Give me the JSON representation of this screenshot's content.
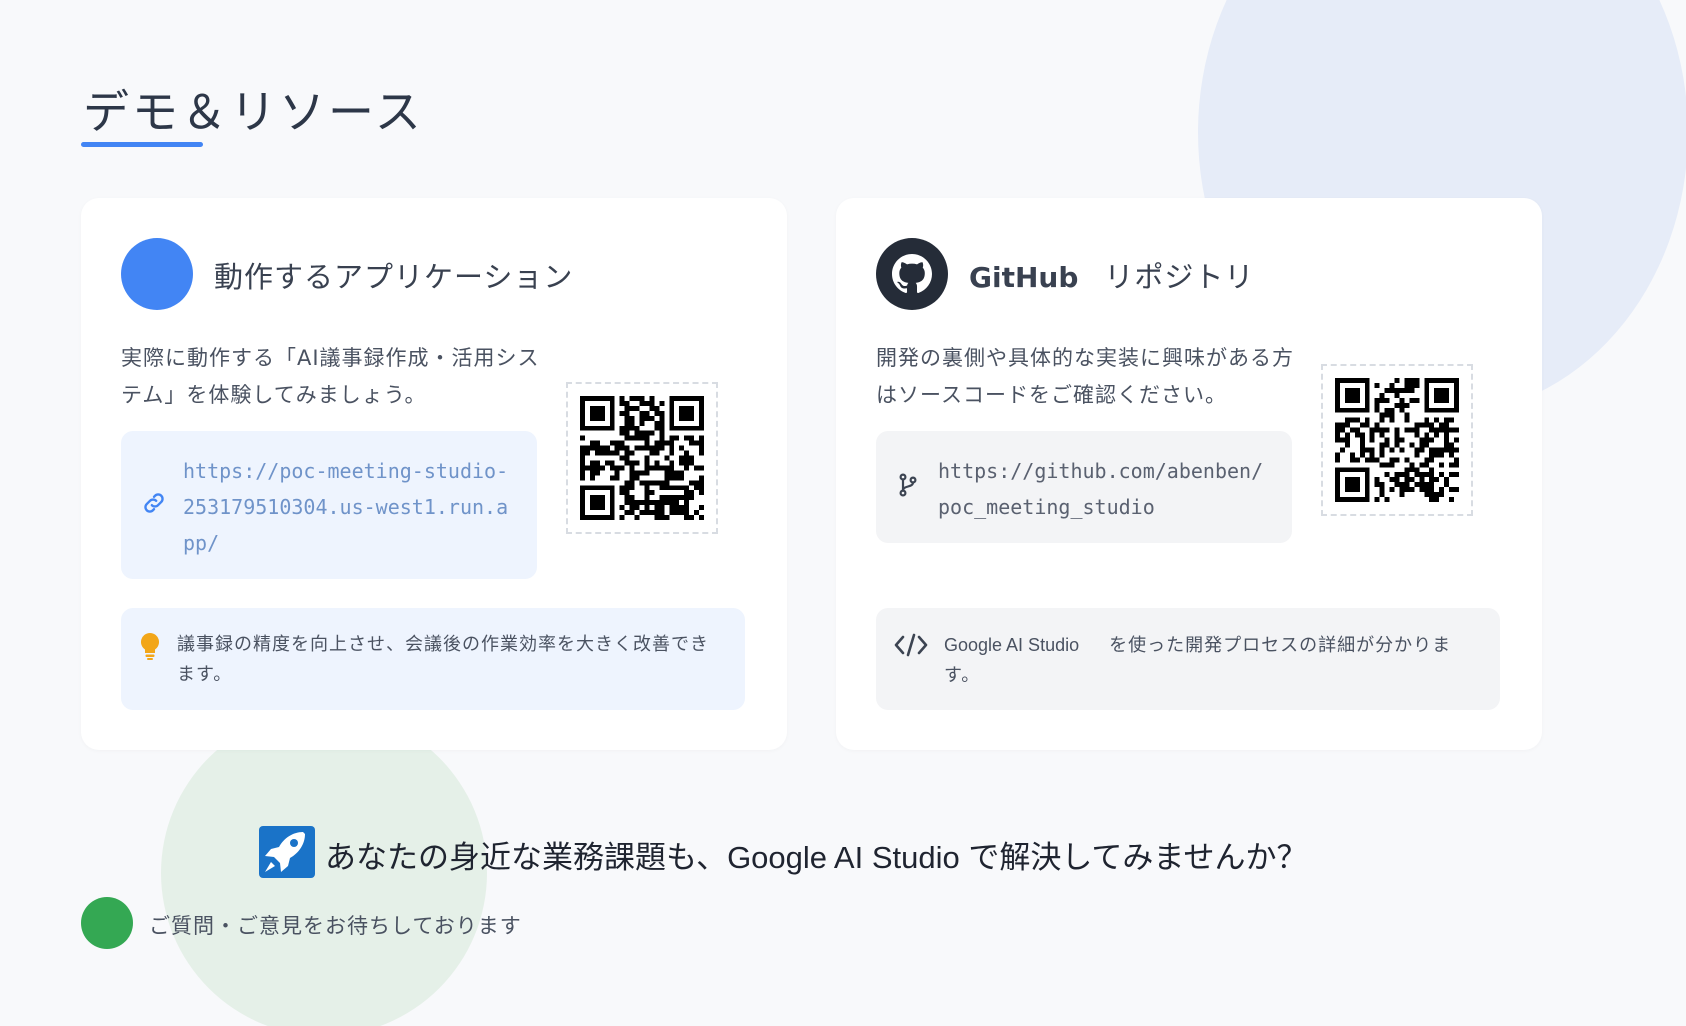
{
  "page": {
    "title": "デモ＆リソース"
  },
  "colors": {
    "accent_blue": "#4285f4",
    "dark": "#252c38",
    "green": "#34a853",
    "amber": "#f2a619"
  },
  "app_card": {
    "icon": "app-circle-icon",
    "title": "動作するアプリケーション",
    "description": "実際に動作する「AI議事録作成・活用システム」を体験してみましょう。",
    "url": "https://poc-meeting-studio-253179510304.us-west1.run.app/",
    "url_icon": "link-icon",
    "qr_icon": "qr-code-icon",
    "note_icon": "lightbulb-icon",
    "note": "議事録の精度を向上させ、会議後の作業効率を大きく改善できます。"
  },
  "github_card": {
    "icon": "github-icon",
    "title_brand": "GitHub",
    "title": "リポジトリ",
    "description": "開発の裏側や具体的な実装に興味がある方はソースコードをご確認ください。",
    "url": "https://github.com/abenben/poc_meeting_studio",
    "url_icon": "git-branch-icon",
    "qr_icon": "qr-code-icon",
    "note_icon": "code-icon",
    "note_brand": "Google AI Studio",
    "note": "を使った開発プロセスの詳細が分かります。"
  },
  "cta": {
    "icon": "rocket-icon",
    "text": "あなたの身近な業務課題も、Google AI Studio で解決してみませんか？"
  },
  "footer": {
    "text": "ご質問・ご意見をお待ちしております"
  }
}
